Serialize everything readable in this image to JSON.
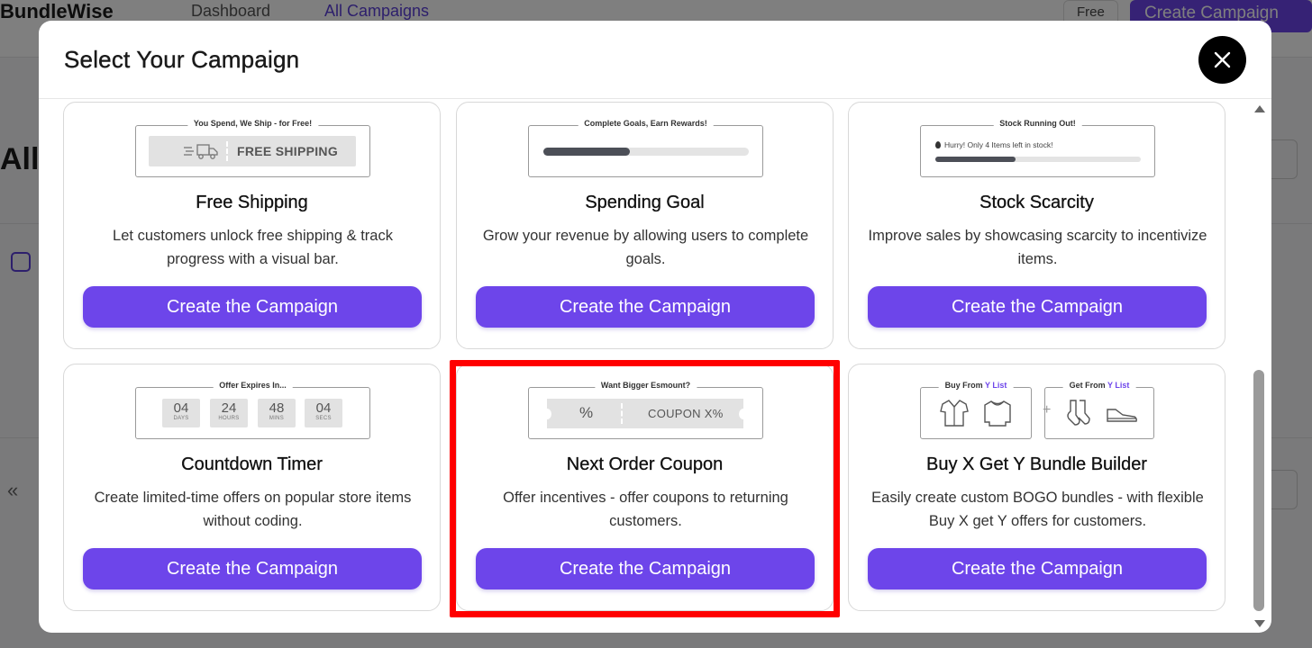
{
  "background": {
    "brand": "BundleWise",
    "nav": [
      "Dashboard",
      "All Campaigns"
    ],
    "plan_badge": "Free",
    "create_button": "Create Campaign",
    "page_heading": "All",
    "pager_icon": "«"
  },
  "modal": {
    "title": "Select Your Campaign",
    "close_icon": "close-icon"
  },
  "cards": [
    {
      "preview_caption": "You Spend, We Ship - for Free!",
      "preview_label": "FREE SHIPPING",
      "title": "Free Shipping",
      "description": "Let customers unlock free shipping & track progress with a visual bar.",
      "cta": "Create the Campaign"
    },
    {
      "preview_caption": "Complete Goals, Earn Rewards!",
      "progress": 0.42,
      "title": "Spending Goal",
      "description": "Grow your revenue by allowing users to complete goals.",
      "cta": "Create the Campaign"
    },
    {
      "preview_caption": "Stock Running Out!",
      "preview_message": "Hurry! Only 4 Items left in stock!",
      "progress": 0.39,
      "title": "Stock Scarcity",
      "description": "Improve sales by showcasing scarcity to incentivize items.",
      "cta": "Create the Campaign"
    },
    {
      "preview_caption": "Offer Expires In...",
      "timer": [
        {
          "value": "04",
          "label": "DAYS"
        },
        {
          "value": "24",
          "label": "HOURS"
        },
        {
          "value": "48",
          "label": "MINS"
        },
        {
          "value": "04",
          "label": "SECS"
        }
      ],
      "title": "Countdown Timer",
      "description": "Create limited-time offers on popular store items without coding.",
      "cta": "Create the Campaign"
    },
    {
      "preview_caption": "Want Bigger Esmount?",
      "coupon_symbol": "%",
      "coupon_code": "COUPON X%",
      "title": "Next Order Coupon",
      "description": "Offer incentives - offer coupons to returning customers.",
      "cta": "Create the Campaign",
      "highlighted": true
    },
    {
      "preview_caption_left_prefix": "Buy From",
      "preview_caption_left_y": "Y",
      "preview_caption_left_list": "List",
      "preview_caption_right_prefix": "Get From",
      "preview_caption_right_y": "Y",
      "preview_caption_right_list": "List",
      "plus": "+",
      "title": "Buy X Get Y Bundle Builder",
      "description": "Easily create custom BOGO bundles - with flexible Buy X get Y offers for customers.",
      "cta": "Create the Campaign"
    }
  ],
  "colors": {
    "accent": "#6d45ea",
    "highlight": "#ff0000",
    "overlay": "rgba(0,0,0,0.5)"
  }
}
